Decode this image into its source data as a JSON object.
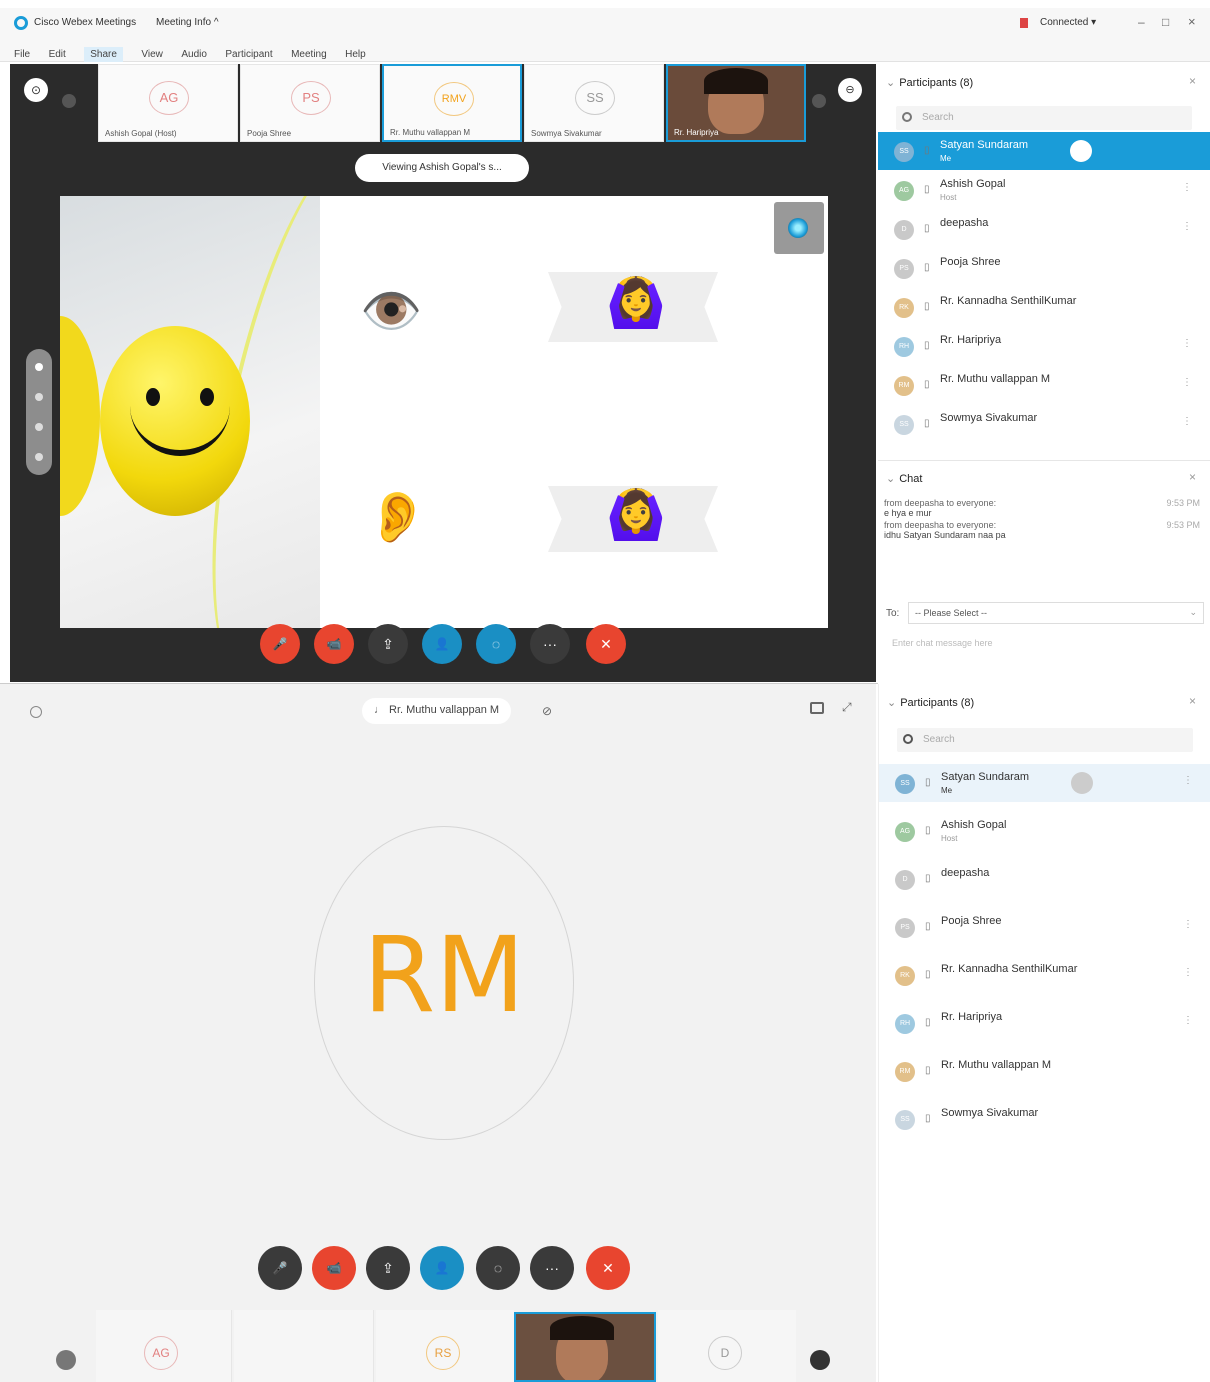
{
  "app": {
    "title": "Cisco Webex Meetings",
    "meeting_info": "Meeting Info ^",
    "status": "Connected ▾",
    "window_controls": [
      "–",
      "□",
      "×"
    ]
  },
  "menu": [
    "File",
    "Edit",
    "Share",
    "View",
    "Audio",
    "Participant",
    "Meeting",
    "Help"
  ],
  "thumbs": [
    {
      "initials": "AG",
      "name": "Ashish Gopal (Host)"
    },
    {
      "initials": "PS",
      "name": "Pooja Shree"
    },
    {
      "initials": "RMV",
      "name": "Rr. Muthu vallappan M"
    },
    {
      "initials": "SS",
      "name": "Sowmya Sivakumar"
    },
    {
      "initials": "",
      "name": "Rr. Haripriya"
    }
  ],
  "viewing_label": "Viewing Ashish Gopal's s...",
  "slide": {
    "eye_emoji": "👁️",
    "ear_emoji": "👂",
    "girl_emoji": "🙆‍♀️",
    "smiley": "☺"
  },
  "top_controls": [
    "🎤",
    "📹",
    "⇪",
    "👤",
    "◌",
    "···",
    "✕"
  ],
  "participants_top": {
    "header": "Participants (8)",
    "search_placeholder": "Search",
    "rows": [
      {
        "initials": "SS",
        "name": "Satyan Sundaram",
        "sub": "Me",
        "right": ""
      },
      {
        "initials": "AG",
        "name": "Ashish Gopal",
        "sub": "Host",
        "right": "⋮"
      },
      {
        "initials": "D",
        "name": "deepasha",
        "sub": "",
        "right": "⋮"
      },
      {
        "initials": "PS",
        "name": "Pooja Shree",
        "sub": "",
        "right": ""
      },
      {
        "initials": "RK",
        "name": "Rr. Kannadha SenthilKumar",
        "sub": "",
        "right": ""
      },
      {
        "initials": "RH",
        "name": "Rr. Haripriya",
        "sub": "",
        "right": "⋮"
      },
      {
        "initials": "RM",
        "name": "Rr. Muthu vallappan M",
        "sub": "",
        "right": "⋮"
      },
      {
        "initials": "SS",
        "name": "Sowmya Sivakumar",
        "sub": "",
        "right": "⋮"
      }
    ]
  },
  "chat": {
    "header": "Chat",
    "messages": [
      {
        "from": "from deepasha to everyone:",
        "time": "9:53 PM",
        "text": "e hya e mur"
      },
      {
        "from": "from deepasha to everyone:",
        "time": "9:53 PM",
        "text": "idhu Satyan Sundaram naa pa"
      }
    ],
    "to_label": "To:",
    "to_value": "-- Please Select --",
    "input_placeholder": "Enter chat message here"
  },
  "bottom": {
    "active_speaker": "Rr. Muthu vallappan M",
    "big_initials": "RM",
    "controls": [
      "🎤",
      "📹",
      "⇪",
      "👤",
      "◌",
      "···",
      "✕"
    ],
    "strip": [
      {
        "initials": "AG"
      },
      {
        "initials": ""
      },
      {
        "initials": "RS"
      },
      {
        "initials": ""
      },
      {
        "initials": "D"
      }
    ]
  },
  "participants_bottom": {
    "header": "Participants (8)",
    "search_placeholder": "Search",
    "rows": [
      {
        "initials": "SS",
        "name": "Satyan Sundaram",
        "sub": "Me",
        "right": "⋮"
      },
      {
        "initials": "AG",
        "name": "Ashish Gopal",
        "sub": "Host",
        "right": ""
      },
      {
        "initials": "D",
        "name": "deepasha",
        "sub": "",
        "right": ""
      },
      {
        "initials": "PS",
        "name": "Pooja Shree",
        "sub": "",
        "right": "⋮"
      },
      {
        "initials": "RK",
        "name": "Rr. Kannadha SenthilKumar",
        "sub": "",
        "right": "⋮"
      },
      {
        "initials": "RH",
        "name": "Rr. Haripriya",
        "sub": "",
        "right": "⋮"
      },
      {
        "initials": "RM",
        "name": "Rr. Muthu vallappan M",
        "sub": "",
        "right": ""
      },
      {
        "initials": "SS",
        "name": "Sowmya Sivakumar",
        "sub": "",
        "right": ""
      }
    ]
  },
  "colors": {
    "accent": "#1a9cd8",
    "red": "#e8452f",
    "dark": "#3a3a3a",
    "initials_orange": "#f2a21b"
  }
}
